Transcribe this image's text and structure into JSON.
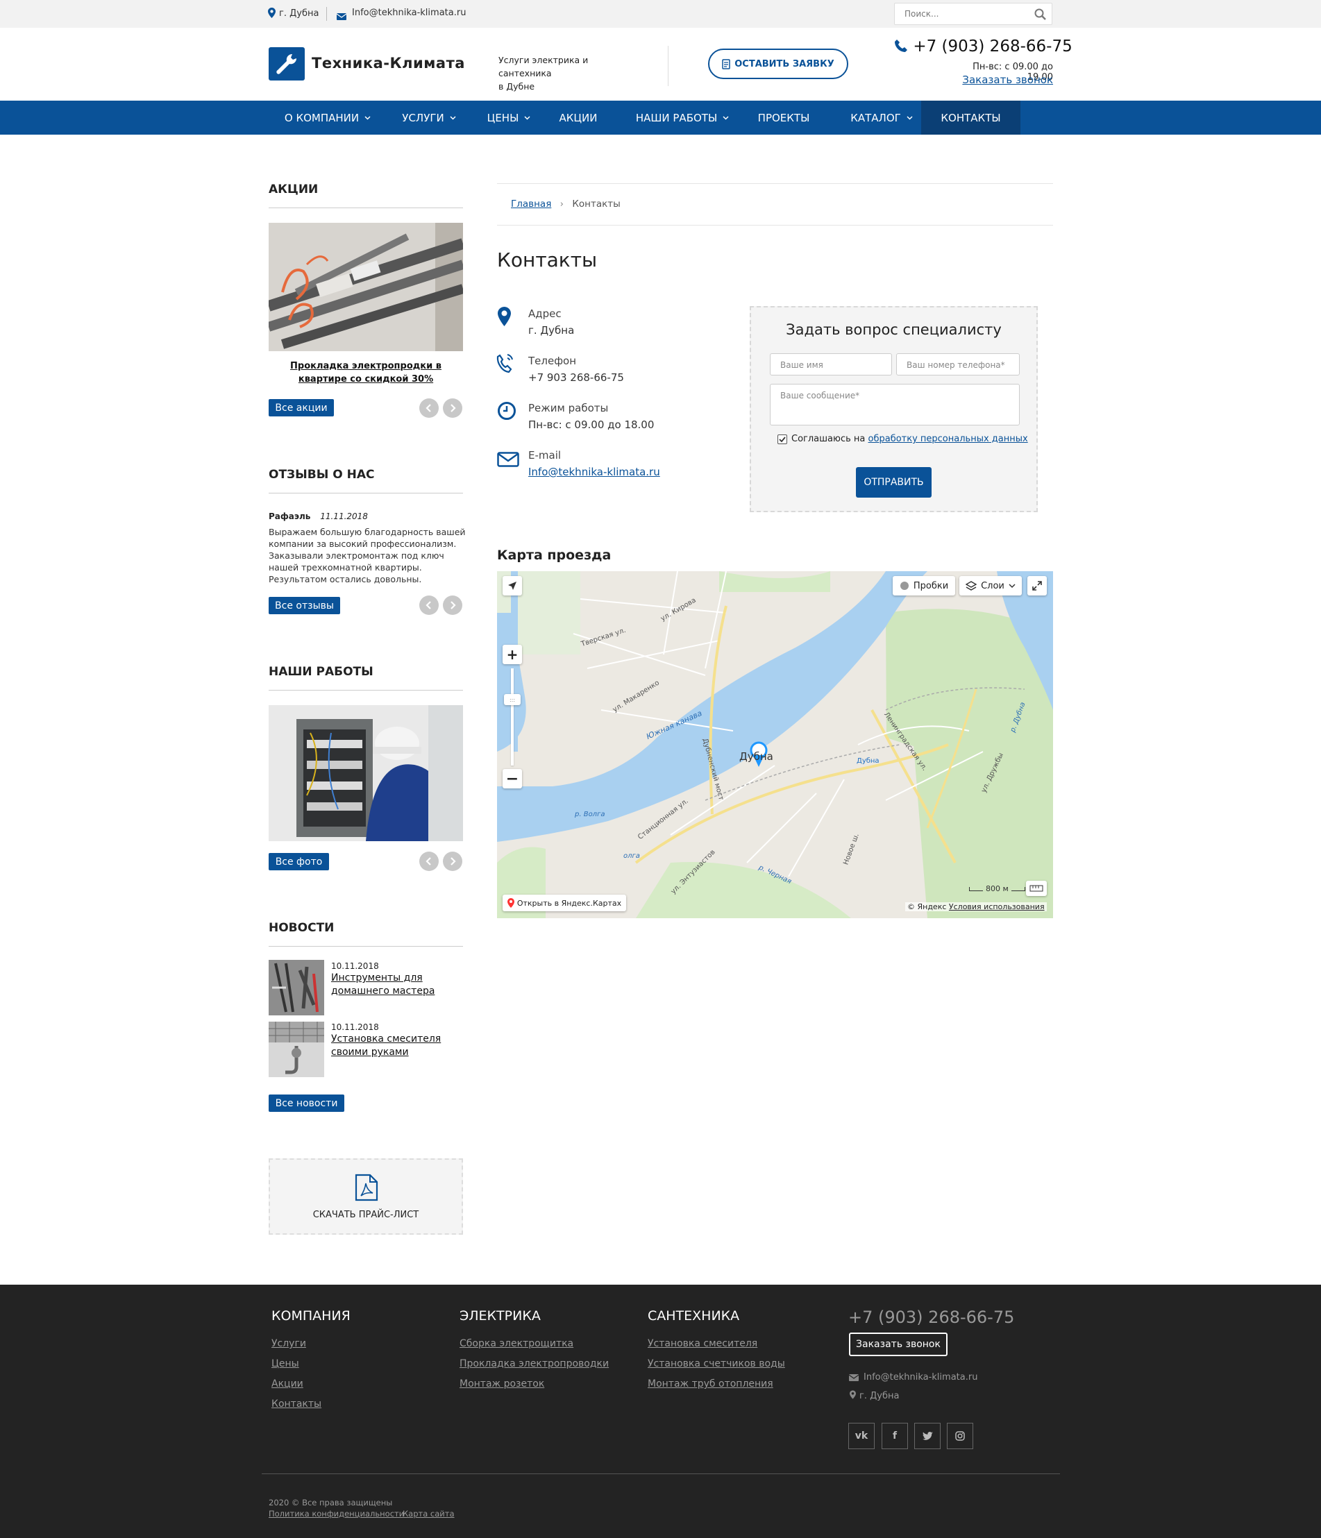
{
  "topbar": {
    "city": "г. Дубна",
    "email": "Info@tekhnika-klimata.ru",
    "search_placeholder": "Поиск..."
  },
  "header": {
    "logo_text": "Техника-Климата",
    "slogan_line1": "Услуги электрика и сантехника",
    "slogan_line2": "в Дубне",
    "request_button": "ОСТАВИТЬ ЗАЯВКУ",
    "phone": "+7 (903) 268-66-75",
    "hours": "Пн-вс: с 09.00 до 19.00",
    "callback_link": "Заказать звонок"
  },
  "nav": {
    "items": [
      {
        "label": "О КОМПАНИИ",
        "has_dropdown": true
      },
      {
        "label": "УСЛУГИ",
        "has_dropdown": true
      },
      {
        "label": "ЦЕНЫ",
        "has_dropdown": true
      },
      {
        "label": "АКЦИИ",
        "has_dropdown": false
      },
      {
        "label": "НАШИ РАБОТЫ",
        "has_dropdown": true
      },
      {
        "label": "ПРОЕКТЫ",
        "has_dropdown": false
      },
      {
        "label": "КАТАЛОГ",
        "has_dropdown": true
      },
      {
        "label": "КОНТАКТЫ",
        "has_dropdown": false,
        "active": true
      }
    ]
  },
  "sidebar": {
    "promos": {
      "title": "АКЦИИ",
      "caption": "Прокладка электропродки в квартире со скидкой 30%",
      "button": "Все акции"
    },
    "reviews": {
      "title": "ОТЗЫВЫ О НАС",
      "author": "Рафаэль",
      "date": "11.11.2018",
      "text_lines": [
        "Выражаем большую благодарность вашей",
        "компании за высокий профессионализм.",
        "Заказывали электромонтаж под ключ",
        "нашей трехкомнатной квартиры.",
        "Результатом остались довольны."
      ],
      "button": "Все отзывы"
    },
    "works": {
      "title": "НАШИ РАБОТЫ",
      "button": "Все фото"
    },
    "news": {
      "title": "НОВОСТИ",
      "items": [
        {
          "date": "10.11.2018",
          "title_line1": "Инструменты для",
          "title_line2": "домашнего мастера"
        },
        {
          "date": "10.11.2018",
          "title_line1": "Установка смесителя",
          "title_line2": "своими руками"
        }
      ],
      "button": "Все новости"
    },
    "pricelist": "СКАЧАТЬ ПРАЙС-ЛИСТ"
  },
  "main": {
    "breadcrumb": {
      "home": "Главная",
      "current": "Контакты"
    },
    "title": "Контакты",
    "contacts": {
      "address_label": "Адрес",
      "address_value": "г. Дубна",
      "phone_label": "Телефон",
      "phone_value": "+7 903 268-66-75",
      "hours_label": "Режим работы",
      "hours_value": "Пн-вс: с 09.00 до 18.00",
      "email_label": "E-mail",
      "email_value": "Info@tekhnika-klimata.ru"
    },
    "form": {
      "title": "Задать вопрос специалисту",
      "name_placeholder": "Ваше имя",
      "phone_placeholder": "Ваш номер телефона*",
      "message_placeholder": "Ваше сообщение*",
      "consent_text": "Соглашаюсь на",
      "consent_link": "обработку персональных данных",
      "submit": "ОТПРАВИТЬ"
    },
    "map": {
      "title": "Карта проезда",
      "traffic": "Пробки",
      "layers": "Слои",
      "open_link": "Открыть в Яндекс.Картах",
      "scale": "800 м",
      "copyright": "© Яндекс",
      "terms": "Условия использования",
      "labels": {
        "city": "Дубна",
        "station": "Дубна",
        "street1": "ул. Кирова",
        "street2": "Тверская ул.",
        "street3": "ул. Макаренко",
        "canal": "Южная канава",
        "bridge": "Дубненский мост",
        "river": "р. Волга",
        "river2": "олга",
        "street4": "Станционная ул.",
        "street5": "ул. Энтузиастов",
        "river3": "р. Черная",
        "road": "Новое ш.",
        "street6": "Ленинградская ул.",
        "street7": "ул. Дружбы",
        "river4": "р. Дубна"
      }
    }
  },
  "footer": {
    "col1": {
      "title": "КОМПАНИЯ",
      "links": [
        "Услуги",
        "Цены",
        "Акции",
        "Контакты"
      ]
    },
    "col2": {
      "title": "ЭЛЕКТРИКА",
      "links": [
        "Сборка электрощитка",
        "Прокладка электропроводки",
        "Монтаж розеток"
      ]
    },
    "col3": {
      "title": "САНТЕХНИКА",
      "links": [
        "Установка смесителя",
        "Установка счетчиков воды",
        "Монтаж труб отопления"
      ]
    },
    "phone": "+7 (903) 268-66-75",
    "callback_button": "Заказать звонок",
    "email": "Info@tekhnika-klimata.ru",
    "city": "г. Дубна",
    "social": {
      "vk": "vk",
      "facebook": "f"
    },
    "copyright": "2020 © Все права защищены",
    "privacy": "Политика конфиденциальности",
    "sitemap": "Карта сайта"
  },
  "colors": {
    "brand": "#0a5298",
    "nav_active": "#0b3f75",
    "footer_bg": "#232323"
  }
}
